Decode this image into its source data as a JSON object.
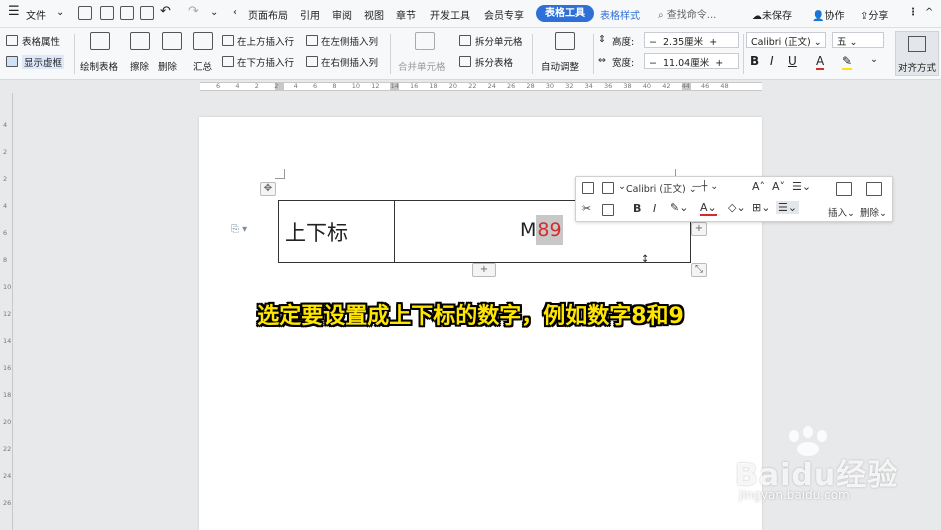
{
  "menubar": {
    "hamburger_label": "文件",
    "items": [
      "页面布局",
      "引用",
      "审阅",
      "视图",
      "章节",
      "开发工具",
      "会员专享"
    ],
    "active_tab": "表格工具",
    "design_tab": "表格样式",
    "search_placeholder": "查找命令...",
    "save_status": "未保存",
    "collab": "协作",
    "share": "分享"
  },
  "ribbon": {
    "table_props": "表格属性",
    "show_gridlines": "显示虚框",
    "draw_table": "绘制表格",
    "erase": "擦除",
    "delete": "删除",
    "summary": "汇总",
    "insert_above": "在上方插入行",
    "insert_below": "在下方插入行",
    "insert_left": "在左侧插入列",
    "insert_right": "在右侧插入列",
    "merge_cells": "合并单元格",
    "split_cells": "拆分单元格",
    "split_table": "拆分表格",
    "autofit": "自动调整",
    "height_label": "高度:",
    "height_value": "2.35厘米",
    "width_label": "宽度:",
    "width_value": "11.04厘米",
    "font_name": "Calibri (正文)",
    "font_size": "五",
    "align_label": "对齐方式",
    "bold": "B",
    "italic": "I",
    "underline": "U",
    "font_color": "A"
  },
  "ruler": {
    "h_numbers": [
      "6",
      "4",
      "2",
      "2",
      "4",
      "6",
      "8",
      "10",
      "12",
      "14",
      "16",
      "18",
      "20",
      "22",
      "24",
      "26",
      "28",
      "30",
      "32",
      "34",
      "36",
      "38",
      "40",
      "42",
      "44",
      "46",
      "48"
    ],
    "v_numbers": [
      "4",
      "2",
      "2",
      "4",
      "6",
      "8",
      "10",
      "12",
      "14",
      "16",
      "18",
      "20",
      "22",
      "24",
      "26"
    ]
  },
  "table": {
    "cell1": "上下标",
    "cell2_prefix": "M",
    "cell2_selected": "89",
    "add_row": "+",
    "add_col": "+"
  },
  "float_toolbar": {
    "font_name": "Calibri (正文)",
    "bold": "B",
    "italic": "I",
    "insert": "插入",
    "delete": "删除"
  },
  "caption": "选定要设置成上下标的数字，例如数字8和9",
  "watermark": {
    "logo": "Baidu经验",
    "url": "jingyan.baidu.com"
  },
  "colors": {
    "accent": "#2f6fd8",
    "caption": "#ffe600",
    "selected_text": "#d62b2b"
  }
}
